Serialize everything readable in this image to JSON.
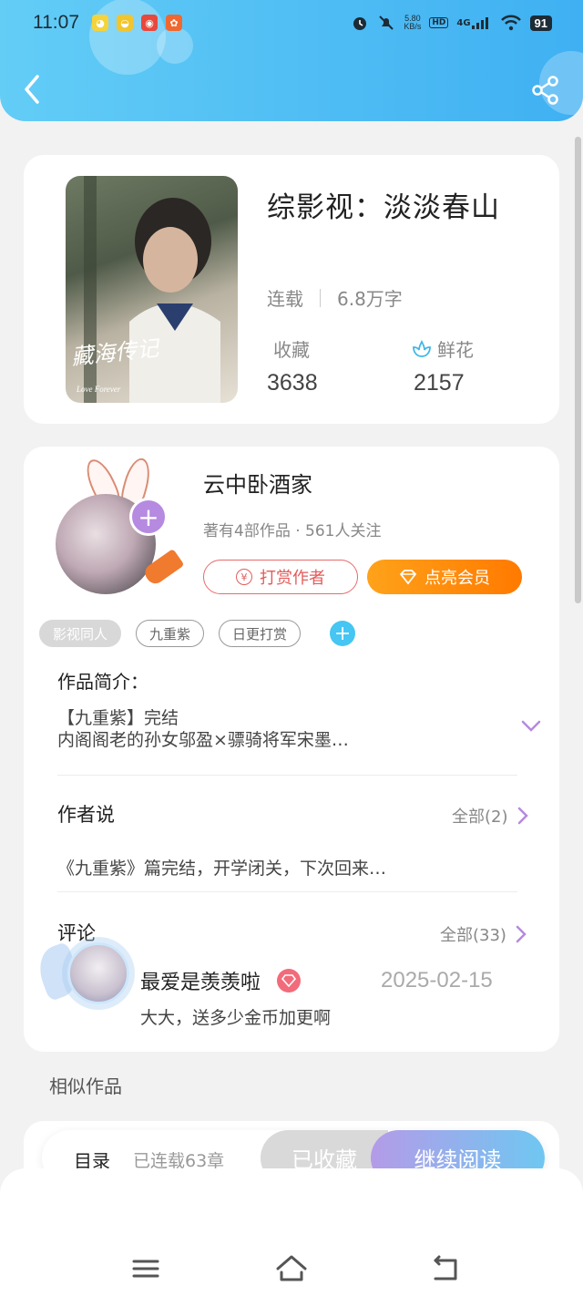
{
  "status_bar": {
    "time": "11:07",
    "net_speed_value": "5.80",
    "net_speed_unit": "KB/s",
    "hd_label": "HD",
    "network_label": "4G",
    "battery": "91",
    "notification_icons": [
      "app-icon-1",
      "app-icon-2",
      "weibo-icon",
      "app-icon-4"
    ]
  },
  "book": {
    "title": "综影视：淡淡春山",
    "status": "连载",
    "word_count": "6.8万字",
    "favorites_label": "收藏",
    "favorites_value": "3638",
    "flowers_label": "鲜花",
    "flowers_value": "2157",
    "cover_text": "藏海传记",
    "cover_small_text": "Love Forever"
  },
  "author": {
    "name": "云中卧酒家",
    "stats": "著有4部作品 · 561人关注",
    "reward_button": "打赏作者",
    "vip_button": "点亮会员"
  },
  "tags": [
    "影视同人",
    "九重紫",
    "日更打赏"
  ],
  "intro": {
    "heading": "作品简介：",
    "line1": "【九重紫】完结",
    "line2": "内阁阁老的孙女邬盈×骠骑将军宋墨…"
  },
  "author_says": {
    "heading": "作者说",
    "see_all": "全部(2)",
    "text": "《九重紫》篇完结，开学闭关，下次回来…"
  },
  "comments": {
    "heading": "评论",
    "see_all": "全部(33)",
    "items": [
      {
        "user": "最爱是羡羡啦",
        "date": "2025-02-15",
        "text": "大大，送多少金币加更啊"
      }
    ]
  },
  "similar": {
    "heading": "相似作品"
  },
  "bottom_bar": {
    "toc": "目录",
    "chapter_count": "已连载63章",
    "collected": "已收藏",
    "continue_reading": "继续阅读"
  },
  "colors": {
    "header_start": "#63cdf6",
    "header_end": "#3fb0f2",
    "vip_orange": "#ff8a00",
    "reward_red": "#e45b5b",
    "accent_purple": "#b58ae0",
    "tag_add_blue": "#45c6f3"
  }
}
